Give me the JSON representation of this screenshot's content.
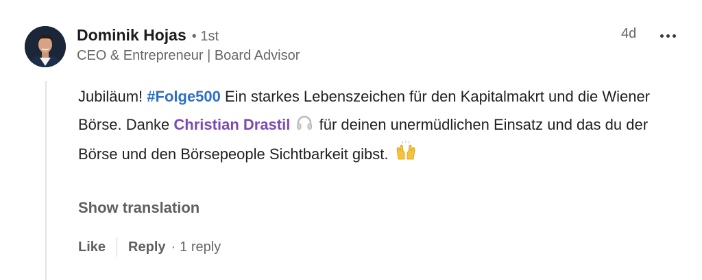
{
  "comment": {
    "author": {
      "name": "Dominik Hojas",
      "degree": "• 1st",
      "headline": "CEO & Entrepreneur | Board Advisor"
    },
    "timestamp": "4d",
    "more_icon": "ellipsis-icon",
    "body": {
      "part1": "Jubiläum! ",
      "hashtag": "#Folge500",
      "part2": " Ein starkes Lebenszeichen für den Kapitalmakrt und die Wiener Börse. Danke ",
      "mention": "Christian Drastil",
      "part3": " für deinen unermüdlichen Einsatz und das du der Börse und den Börsepeople Sichtbarkeit gibst. ",
      "emoji_headphones": "headphones-icon",
      "emoji_raised_hands": "raised-hands-icon"
    },
    "show_translation": "Show translation",
    "actions": {
      "like": "Like",
      "reply": "Reply",
      "separator": "·",
      "reply_count": "1 reply"
    }
  },
  "colors": {
    "hashtag": "#2f6fc4",
    "mention": "#7b4bb3",
    "secondary_text": "#666666"
  }
}
